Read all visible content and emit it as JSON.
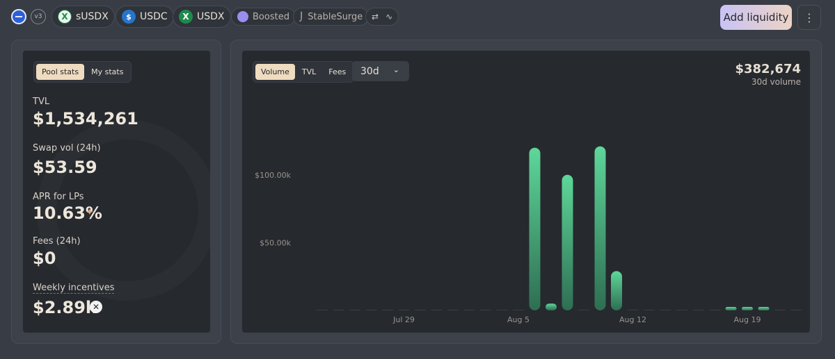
{
  "header": {
    "version_badge": "v3",
    "tokens": [
      {
        "symbol": "sUSDX",
        "icon": "usdx-icon"
      },
      {
        "symbol": "USDC",
        "icon": "usdc-icon"
      },
      {
        "symbol": "USDX",
        "icon": "usdx-icon"
      }
    ],
    "tags": {
      "boosted": "Boosted",
      "hook": "StableSurge"
    },
    "add_liquidity_label": "Add liquidity",
    "more_label": "⋮"
  },
  "stats": {
    "tabs": [
      {
        "label": "Pool stats",
        "active": true
      },
      {
        "label": "My stats",
        "active": false
      }
    ],
    "tvl_label": "TVL",
    "tvl_value": "$1,534,261",
    "swap_label": "Swap vol (24h)",
    "swap_value": "$53.59",
    "apr_label": "APR for LPs",
    "apr_value": "10.63%",
    "fees_label": "Fees (24h)",
    "fees_value": "$0",
    "incentives_label": "Weekly incentives",
    "incentives_value": "$2.89k"
  },
  "chart_panel": {
    "tabs": [
      {
        "label": "Volume",
        "active": true
      },
      {
        "label": "TVL",
        "active": false
      },
      {
        "label": "Fees",
        "active": false
      }
    ],
    "range": "30d",
    "total": "$382,674",
    "total_caption": "30d volume"
  },
  "colors": {
    "accent": "#efdcc0",
    "bar_top": "#5ed79a",
    "bar_bottom": "#2e6e52"
  },
  "chart_data": {
    "type": "bar",
    "x_ticks": [
      "Jul 29",
      "Aug 5",
      "Aug 12",
      "Aug 19"
    ],
    "y_ticks": [
      "$50.00k",
      "$100.00k"
    ],
    "y_tick_values": [
      50000,
      100000
    ],
    "ylim": [
      0,
      125000
    ],
    "grid": false,
    "categories": [
      "Jul 24",
      "Jul 25",
      "Jul 26",
      "Jul 27",
      "Jul 28",
      "Jul 29",
      "Jul 30",
      "Jul 31",
      "Aug 1",
      "Aug 2",
      "Aug 3",
      "Aug 4",
      "Aug 5",
      "Aug 6",
      "Aug 7",
      "Aug 8",
      "Aug 9",
      "Aug 10",
      "Aug 11",
      "Aug 12",
      "Aug 13",
      "Aug 14",
      "Aug 15",
      "Aug 16",
      "Aug 17",
      "Aug 18",
      "Aug 19",
      "Aug 20",
      "Aug 21",
      "Aug 22"
    ],
    "values": [
      0,
      0,
      0,
      0,
      0,
      0,
      0,
      0,
      0,
      0,
      0,
      0,
      0,
      120000,
      5000,
      100000,
      0,
      121000,
      29000,
      0,
      0,
      0,
      0,
      0,
      0,
      1500,
      1200,
      300,
      0,
      0
    ]
  }
}
